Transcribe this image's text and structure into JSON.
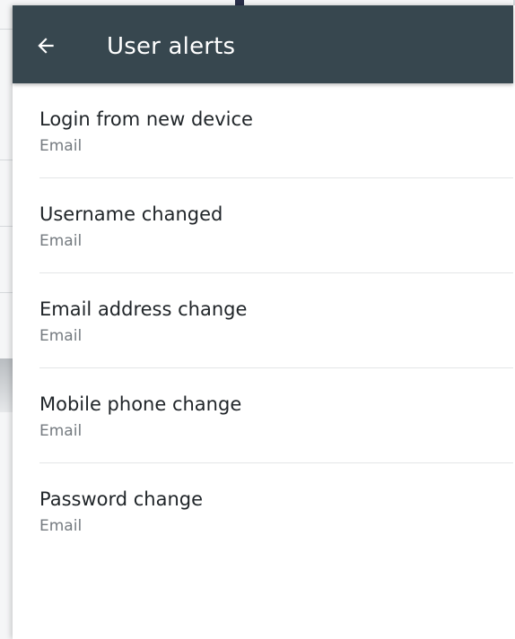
{
  "appbar": {
    "title": "User alerts",
    "back_icon": "arrow-left-icon",
    "color": "#37474f"
  },
  "alerts": [
    {
      "title": "Login from new device",
      "channel": "Email"
    },
    {
      "title": "Username changed",
      "channel": "Email"
    },
    {
      "title": "Email address change",
      "channel": "Email"
    },
    {
      "title": "Mobile phone change",
      "channel": "Email"
    },
    {
      "title": "Password change",
      "channel": "Email"
    }
  ]
}
